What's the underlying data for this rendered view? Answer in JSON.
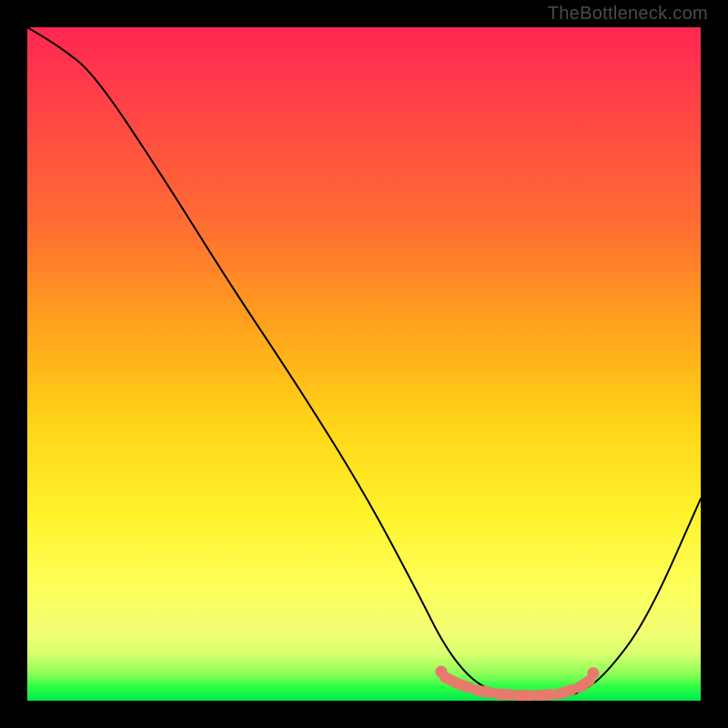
{
  "watermark": "TheBottleneck.com",
  "colors": {
    "salmon": "#e77a6d",
    "line": "#000000"
  },
  "chart_data": {
    "type": "line",
    "title": "",
    "xlabel": "",
    "ylabel": "",
    "xlim": [
      0,
      100
    ],
    "ylim": [
      0,
      100
    ],
    "note": "Axes are implicit (no ticks or labels shown); values are estimated normalized percentages",
    "series": [
      {
        "name": "bottleneck-curve",
        "x": [
          0,
          5,
          10,
          20,
          30,
          40,
          50,
          58,
          62,
          66,
          70,
          74,
          78,
          82,
          86,
          92,
          100
        ],
        "y": [
          100,
          97,
          93,
          78,
          62,
          47,
          31,
          16,
          8,
          3,
          1,
          0.5,
          0.5,
          1,
          4,
          12,
          30
        ]
      }
    ],
    "markers": {
      "name": "highlight-points",
      "style": "salmon-dots",
      "x": [
        62,
        64,
        67,
        70,
        73,
        76,
        79,
        82,
        83.5
      ],
      "y": [
        3.5,
        2.5,
        1.5,
        1.0,
        0.8,
        0.8,
        1.0,
        2.0,
        3.0
      ]
    }
  }
}
